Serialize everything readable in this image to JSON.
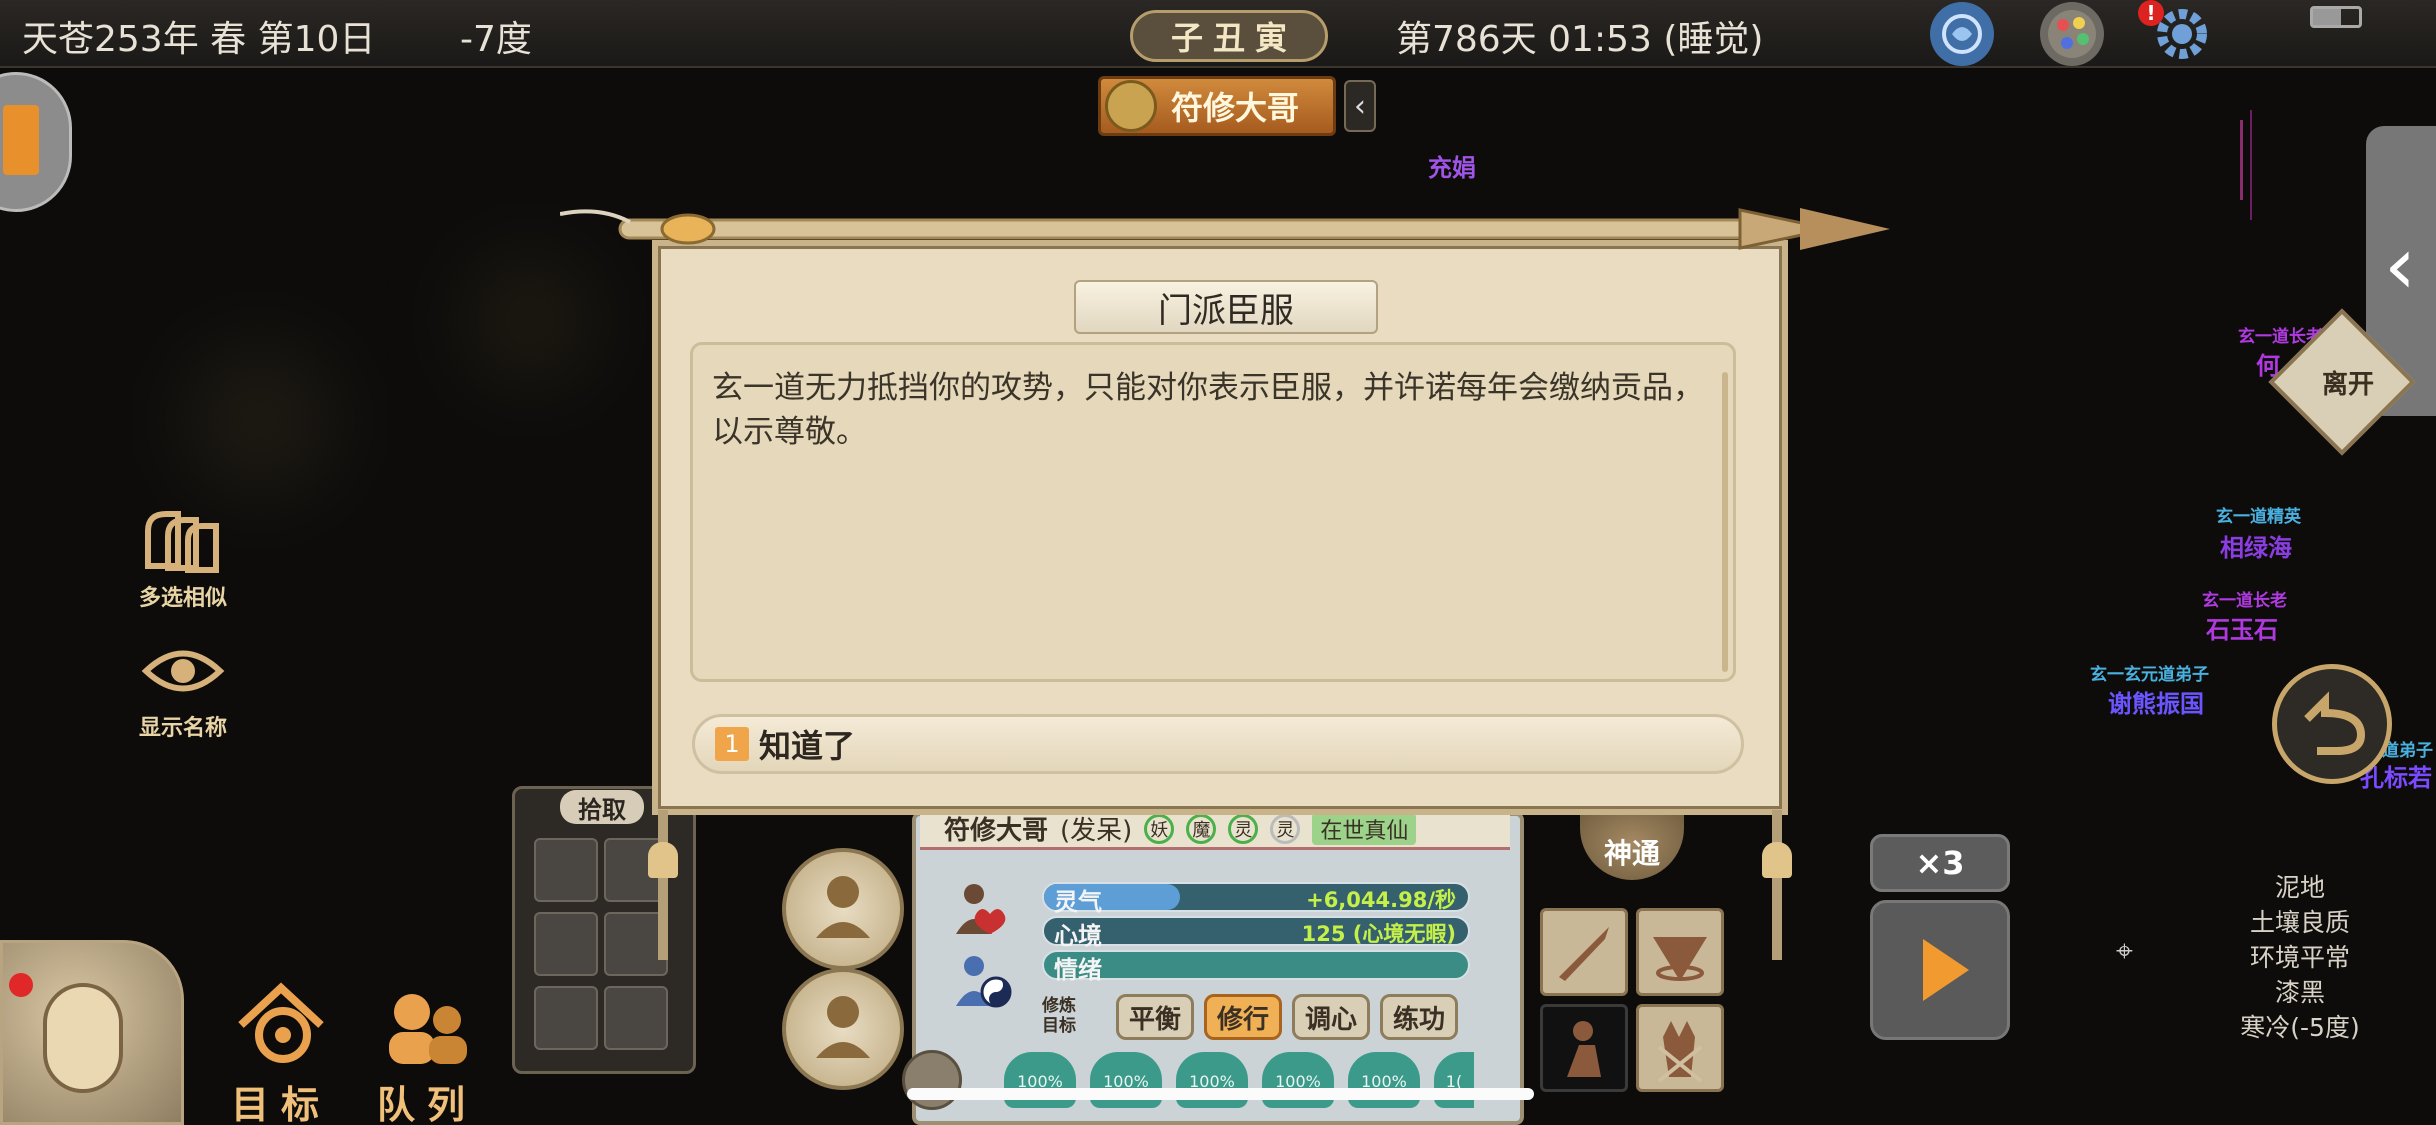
{
  "topbar": {
    "date": "天苍253年 春 第10日",
    "temperature": "-7度",
    "zodiac": [
      "子",
      "丑",
      "寅"
    ],
    "day_time": "第786天 01:53 (睡觉)"
  },
  "character_tag": {
    "name": "符修大哥"
  },
  "map_label": "充娟",
  "left_tools": [
    {
      "label": "多选相似"
    },
    {
      "label": "显示名称"
    }
  ],
  "bottom_nav": [
    {
      "label": "目标"
    },
    {
      "label": "队列"
    }
  ],
  "loot_panel": {
    "title": "拾取"
  },
  "dialog": {
    "title": "门派臣服",
    "message": "玄一道无力抵挡你的攻势，只能对你表示臣服，并许诺每年会缴纳贡品，以示尊敬。",
    "option_number": "1",
    "option_label": "知道了"
  },
  "status_panel": {
    "name": "符修大哥",
    "tag": "(发呆)",
    "traits": [
      "妖",
      "魔",
      "灵",
      "灵"
    ],
    "realm": "在世真仙",
    "qi_label": "灵气",
    "qi_value": "+6,044.98/秒",
    "mind_label": "心境",
    "mind_value": "125 (心境无暇)",
    "emotion_label": "情绪",
    "train_target": "修炼目标",
    "actions": [
      "平衡",
      "修行",
      "调心",
      "练功"
    ],
    "active_action": "修行",
    "percents": [
      "100%",
      "100%",
      "100%",
      "100%",
      "100%",
      "1("
    ]
  },
  "shentong_label": "神通",
  "speed": {
    "label": "×3"
  },
  "right_entities": [
    {
      "title": "玄一道长老",
      "name": "何",
      "color": "#b03ae0"
    },
    {
      "title": "玄一道精英",
      "name": "相绿海",
      "color": "#8a3de0"
    },
    {
      "title": "玄一道长老",
      "name": "石玉石",
      "color": "#b03ae0"
    },
    {
      "title": "玄一玄元道弟子",
      "name": "谢熊振国",
      "color": "#6b55ff"
    },
    {
      "title": "道弟子",
      "name": "孔标若",
      "color": "#7a4bff"
    }
  ],
  "leave_label": "离开",
  "environment": [
    "泥地",
    "土壤良质",
    "环境平常",
    "漆黑",
    "寒冷(-5度)"
  ],
  "colors": {
    "accent": "#f0a54a",
    "parchment": "#e9dcc0",
    "gold": "#c8a66a"
  }
}
